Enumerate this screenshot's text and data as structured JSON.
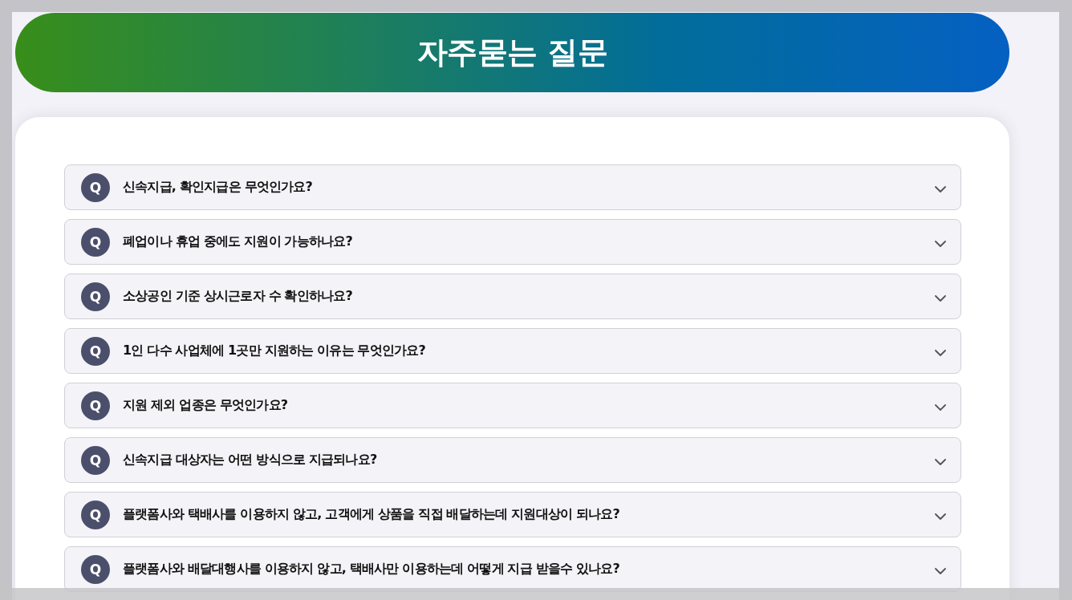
{
  "header": {
    "title": "자주묻는 질문"
  },
  "faq": [
    {
      "marker": "Q",
      "question": "신속지급, 확인지급은 무엇인가요?",
      "expanded": false
    },
    {
      "marker": "Q",
      "question": "폐업이나 휴업 중에도 지원이 가능하나요?",
      "expanded": false
    },
    {
      "marker": "Q",
      "question": "소상공인 기준 상시근로자 수 확인하나요?",
      "expanded": false
    },
    {
      "marker": "Q",
      "question": "1인 다수 사업체에 1곳만 지원하는 이유는 무엇인가요?",
      "expanded": false
    },
    {
      "marker": "Q",
      "question": "지원 제외 업종은 무엇인가요?",
      "expanded": false
    },
    {
      "marker": "Q",
      "question": "신속지급 대상자는 어떤 방식으로 지급되나요?",
      "expanded": false
    },
    {
      "marker": "Q",
      "question": "플랫폼사와 택배사를 이용하지 않고, 고객에게 상품을 직접 배달하는데 지원대상이 되나요?",
      "expanded": false
    },
    {
      "marker": "Q",
      "question": "플랫폼사와 배달대행사를 이용하지 않고, 택배사만 이용하는데 어떻게 지급 받을수 있나요?",
      "expanded": false
    }
  ]
}
